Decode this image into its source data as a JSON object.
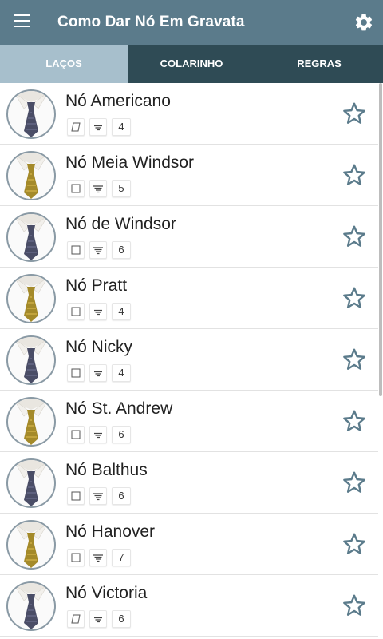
{
  "app": {
    "title": "Como Dar Nó Em Gravata"
  },
  "icons": {
    "menu": "menu-icon",
    "settings": "gear-icon",
    "favorite": "star-outline-icon"
  },
  "tabs": [
    {
      "label": "LAÇOS",
      "active": true
    },
    {
      "label": "COLARINHO",
      "active": false
    },
    {
      "label": "REGRAS",
      "active": false
    }
  ],
  "colors": {
    "appbar": "#5b7b8b",
    "tabbar": "#2f4b55",
    "active_tab": "#a7bfcc",
    "star": "#5b7b8b",
    "tie_blue": "#4a4d66",
    "tie_gold": "#a48a2a"
  },
  "knots": [
    {
      "name": "Nó Americano",
      "collar_icon": "parallelogram-icon",
      "steps_icon": "three-lines-icon",
      "steps": "4",
      "tie_color": "blue"
    },
    {
      "name": "Nó Meia Windsor",
      "collar_icon": "square-icon",
      "steps_icon": "four-lines-icon",
      "steps": "5",
      "tie_color": "gold"
    },
    {
      "name": "Nó de Windsor",
      "collar_icon": "square-icon",
      "steps_icon": "four-lines-icon",
      "steps": "6",
      "tie_color": "blue"
    },
    {
      "name": "Nó Pratt",
      "collar_icon": "square-icon",
      "steps_icon": "three-lines-icon",
      "steps": "4",
      "tie_color": "gold"
    },
    {
      "name": "Nó Nicky",
      "collar_icon": "square-icon",
      "steps_icon": "three-lines-icon",
      "steps": "4",
      "tie_color": "blue"
    },
    {
      "name": "Nó St. Andrew",
      "collar_icon": "square-icon",
      "steps_icon": "three-lines-icon",
      "steps": "6",
      "tie_color": "gold"
    },
    {
      "name": "Nó Balthus",
      "collar_icon": "square-icon",
      "steps_icon": "four-lines-icon",
      "steps": "6",
      "tie_color": "blue"
    },
    {
      "name": "Nó Hanover",
      "collar_icon": "square-icon",
      "steps_icon": "four-lines-icon",
      "steps": "7",
      "tie_color": "gold"
    },
    {
      "name": "Nó Victoria",
      "collar_icon": "parallelogram-icon",
      "steps_icon": "three-lines-icon",
      "steps": "6",
      "tie_color": "blue"
    }
  ]
}
